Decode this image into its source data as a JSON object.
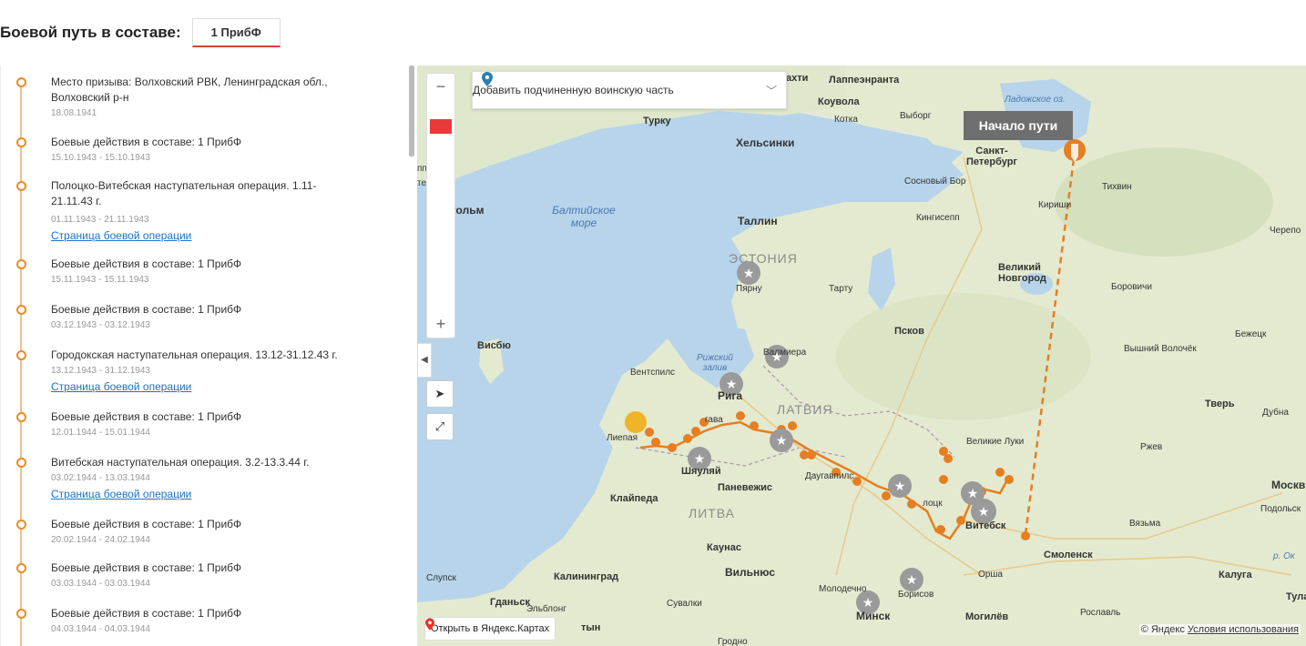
{
  "header": {
    "title": "Боевой путь в составе:",
    "unit_tab": "1 ПрибФ"
  },
  "timeline": [
    {
      "title": "Место призыва: Волховский РВК, Ленинградская обл., Волховский р-н",
      "date": "18.08.1941",
      "link": ""
    },
    {
      "title": "Боевые действия в составе: 1 ПрибФ",
      "date": "15.10.1943 - 15.10.1943",
      "link": ""
    },
    {
      "title": "Полоцко-Витебская наступательная операция. 1.11-21.11.43 г.",
      "date": "01.11.1943 - 21.11.1943",
      "link": "Страница боевой операции"
    },
    {
      "title": "Боевые действия в составе: 1 ПрибФ",
      "date": "15.11.1943 - 15.11.1943",
      "link": ""
    },
    {
      "title": "Боевые действия в составе: 1 ПрибФ",
      "date": "03.12.1943 - 03.12.1943",
      "link": ""
    },
    {
      "title": "Городокская наступательная операция. 13.12-31.12.43 г.",
      "date": "13.12.1943 - 31.12.1943",
      "link": "Страница боевой операции"
    },
    {
      "title": "Боевые действия в составе: 1 ПрибФ",
      "date": "12.01.1944 - 15.01.1944",
      "link": ""
    },
    {
      "title": "Витебская наступательная операция. 3.2-13.3.44 г.",
      "date": "03.02.1944 - 13.03.1944",
      "link": "Страница боевой операции"
    },
    {
      "title": "Боевые действия в составе: 1 ПрибФ",
      "date": "20.02.1944 - 24.02.1944",
      "link": ""
    },
    {
      "title": "Боевые действия в составе: 1 ПрибФ",
      "date": "03.03.1944 - 03.03.1944",
      "link": ""
    },
    {
      "title": "Боевые действия в составе: 1 ПрибФ",
      "date": "04.03.1944 - 04.03.1944",
      "link": ""
    }
  ],
  "map": {
    "dropdown_label": "Добавить подчиненную воинскую часть",
    "tooltip": "Начало пути",
    "open_yandex": "Открыть в Яндекс.Картах",
    "copyright": "© Яндекс",
    "terms_link": "Условия использования",
    "zoom_in": "+",
    "zoom_out": "−",
    "labels": {
      "finland_cities": [
        "ахти",
        "Лаппеэнранта",
        "Коувола",
        "Котка",
        "Выборг",
        "Турку",
        "Хельсинки"
      ],
      "spb": "Санкт-Петербург",
      "ladoga": "Ладожское оз.",
      "sosnovy_bor": "Сосновый Бор",
      "kirishi": "Кириши",
      "tikhvin": "Тихвин",
      "kingisepp": "Кингисепп",
      "tallinn": "Таллин",
      "estonia": "ЭСТОНИЯ",
      "parnu": "Пярну",
      "tartu": "Тарту",
      "novgorod": "Великий Новгород",
      "borovichi": "Боровичи",
      "pskov": "Псков",
      "visby": "Висбю",
      "stockholm": "Стокгольм",
      "uppsala": "ппсала",
      "baltic_sea": "Балтийское море",
      "gulf_riga": "Рижский залив",
      "valmiera": "Валмиера",
      "ventspils": "Вентспилс",
      "riga": "Рига",
      "latvia": "ЛАТВИЯ",
      "liepaja": "Лиепая",
      "jelgava": "гава",
      "shiauliai": "Шяуляй",
      "daugavpils": "Даугавпилс",
      "panevezys": "Паневежис",
      "klaipeda": "Клайпеда",
      "lithuania": "ЛИТВА",
      "kaunas": "Каунас",
      "vilnius": "Вильнюс",
      "kaliningrad": "Калининград",
      "slupsk": "Слупск",
      "gdansk": "Гданьск",
      "elblong": "Эльблонг",
      "suwalki": "Сувалки",
      "molodechno": "Молодечно",
      "minsk": "Минск",
      "borisov": "Борисов",
      "polotsk": "лоцк",
      "vitebsk": "Витебск",
      "velikie_luki": "Великие Луки",
      "orsha": "Орша",
      "smolensk": "Смоленск",
      "mogilev": "Могилёв",
      "roslavl": "Рославль",
      "vyazma": "Вязьма",
      "rzhev": "Ржев",
      "tver": "Тверь",
      "dubna": "Дубна",
      "moscow": "Москв",
      "podolsk": "Подольск",
      "kaluga": "Калуга",
      "tula": "Тула",
      "bezhetsk": "Бежецк",
      "vyshny_volochek": "Вышний Волочёк",
      "cherepovets": "Черепо",
      "grodno": "Гродно",
      "oka": "р. Ок",
      "te": "те",
      "tyn": "тын"
    }
  },
  "colors": {
    "accent": "#f08a24",
    "route": "#e67e22",
    "link": "#1a73c9",
    "tab_border": "#d8423b"
  }
}
